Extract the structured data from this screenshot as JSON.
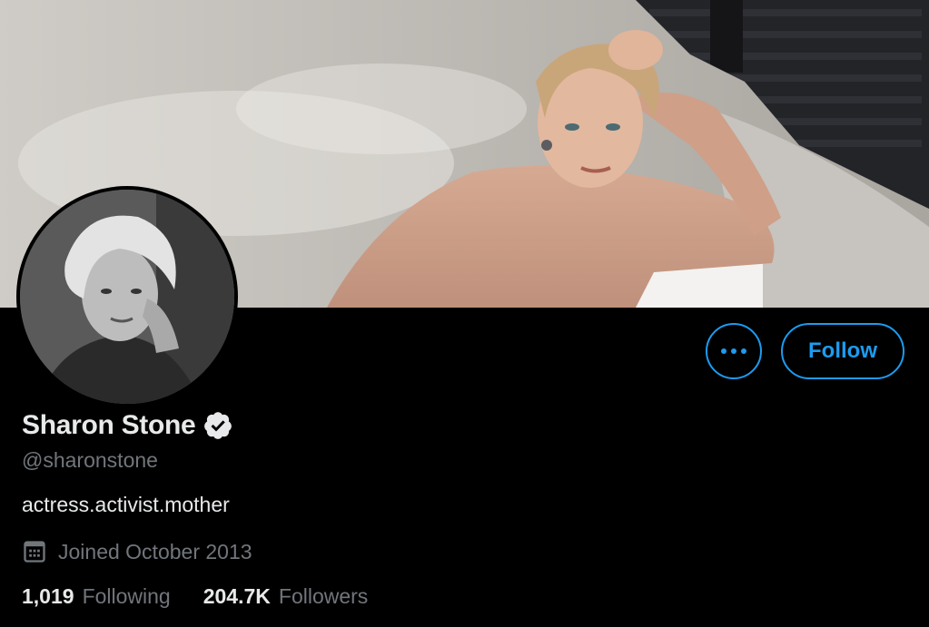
{
  "profile": {
    "name": "Sharon Stone",
    "handle": "@sharonstone",
    "bio": "actress.activist.mother",
    "joined": "Joined October 2013",
    "verified": true
  },
  "stats": {
    "following_count": "1,019",
    "following_label": "Following",
    "followers_count": "204.7K",
    "followers_label": "Followers"
  },
  "actions": {
    "follow_label": "Follow"
  },
  "colors": {
    "accent": "#1d9bf0",
    "background": "#000000",
    "text_primary": "#e7e9ea",
    "text_secondary": "#71767b"
  },
  "icons": {
    "more": "more-icon",
    "verified": "verified-badge-icon",
    "calendar": "calendar-icon"
  }
}
